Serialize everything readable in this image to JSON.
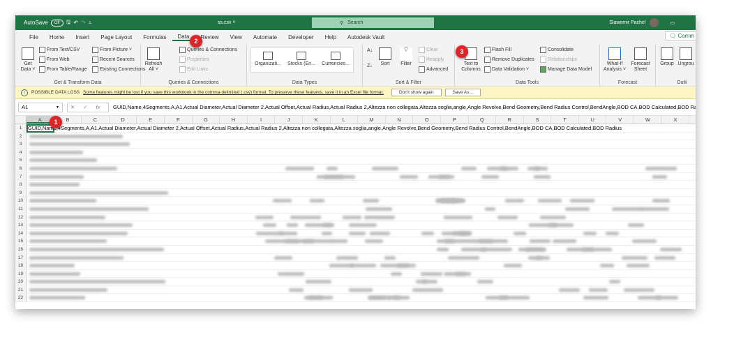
{
  "title": {
    "autosave": "AutoSave",
    "toggle": "Off",
    "filename": "ss.csv ˅",
    "search": "Search",
    "user": "Slawomir Pachel"
  },
  "tabs": [
    "File",
    "Home",
    "Insert",
    "Page Layout",
    "Formulas",
    "Data",
    "Review",
    "View",
    "Automate",
    "Developer",
    "Help",
    "Autodesk Vault"
  ],
  "comments": "Comm",
  "ribbon": {
    "get_data": "Get Data ˅",
    "from_text": "From Text/CSV",
    "from_web": "From Web",
    "from_table": "From Table/Range",
    "from_picture": "From Picture ˅",
    "recent": "Recent Sources",
    "existing": "Existing Connections",
    "g1": "Get & Transform Data",
    "refresh": "Refresh All ˅",
    "queries": "Queries & Connections",
    "properties": "Properties",
    "edit_links": "Edit Links",
    "g2": "Queries & Connections",
    "org": "Organizati...",
    "stocks": "Stocks (En...",
    "curr": "Currencies...",
    "g3": "Data Types",
    "sort": "Sort",
    "filter": "Filter",
    "clear": "Clear",
    "reapply": "Reapply",
    "advanced": "Advanced",
    "g4": "Sort & Filter",
    "ttc": "Text to Columns",
    "flash": "Flash Fill",
    "dups": "Remove Duplicates",
    "valid": "Data Validation ˅",
    "consol": "Consolidate",
    "rel": "Relationships",
    "model": "Manage Data Model",
    "g5": "Data Tools",
    "whatif": "What-If Analysis ˅",
    "forecast": "Forecast Sheet",
    "g6": "Forecast",
    "group": "Group",
    "ungroup": "Ungrou",
    "g7": "Outli"
  },
  "badges": [
    "1",
    "2",
    "3"
  ],
  "notification": {
    "title": "POSSIBLE DATA LOSS",
    "message": "Some features might be lost if you save this workbook in the comma-delimited (.csv) format. To preserve these features, save it in an Excel file format.",
    "dont_show": "Don't show again",
    "save_as": "Save As..."
  },
  "formula_bar": {
    "name_box": "A1",
    "fx": "fx",
    "cancel": "✕",
    "enter": "✓",
    "formula": "GUID,Name,4Segments,A,A1,Actual Diameter,Actual Diameter 2,Actual Offset,Actual Radius,Actual Radius 2,Altezza non collegata,Altezza soglia,angle,Angle Revolve,Bend Geometry,Bend Radius Control,BendAngle,BOD CA,BOD Calculated,BOD Radius"
  },
  "columns": [
    "A",
    "B",
    "C",
    "D",
    "E",
    "F",
    "G",
    "H",
    "I",
    "J",
    "K",
    "L",
    "M",
    "N",
    "O",
    "P",
    "Q",
    "R",
    "S",
    "T",
    "U",
    "V",
    "W",
    "X"
  ],
  "rows": [
    "1",
    "2",
    "3",
    "4",
    "5",
    "6",
    "7",
    "8",
    "9",
    "10",
    "11",
    "12",
    "13",
    "14",
    "15",
    "16",
    "17",
    "18",
    "19",
    "20",
    "21",
    "22"
  ],
  "cell_A1": "GUID,Name,4Segments,A,A1,Actual Diameter,Actual Diameter 2,Actual Offset,Actual Radius,Actual Radius 2,Altezza non collegata,Altezza soglia,angle,Angle Revolve,Bend Geometry,Bend Radius Control,BendAngle,BOD CA,BOD Calculated,BOD Radius"
}
